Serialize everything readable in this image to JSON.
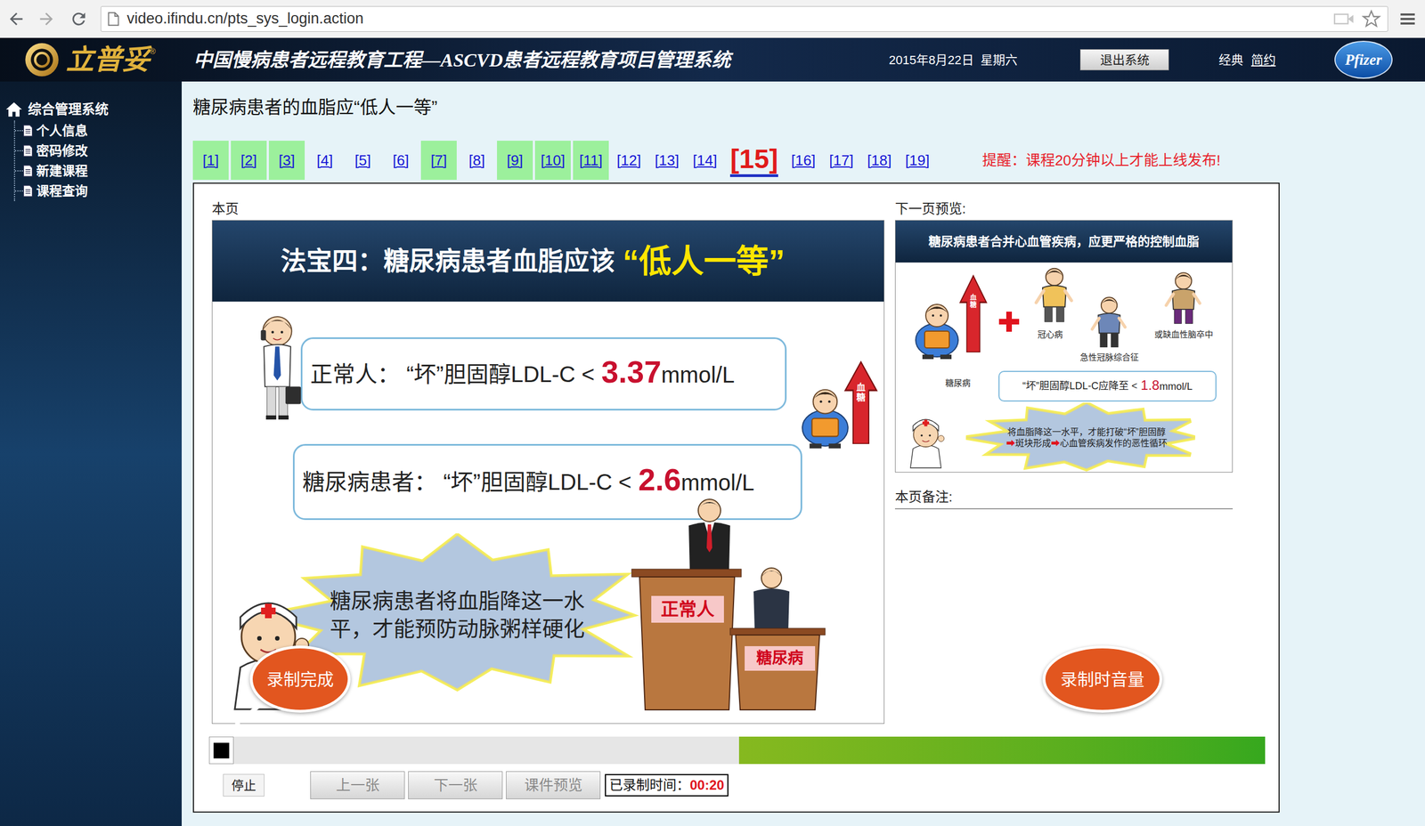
{
  "browser": {
    "url": "video.ifindu.cn/pts_sys_login.action"
  },
  "header": {
    "brand": "立普妥",
    "brand_mark": "®",
    "title": "中国慢病患者远程教育工程—ASCVD患者远程教育项目管理系统",
    "date": "2015年8月22日  星期六",
    "logout": "退出系统",
    "styles": [
      {
        "label": "经典",
        "selected": true
      },
      {
        "label": "简约",
        "selected": false
      }
    ],
    "sponsor": "Pfizer"
  },
  "sidebar": {
    "root": "综合管理系统",
    "items": [
      {
        "label": "个人信息"
      },
      {
        "label": "密码修改"
      },
      {
        "label": "新建课程"
      },
      {
        "label": "课程查询"
      }
    ]
  },
  "course": {
    "title": "糖尿病患者的血脂应“低人一等”",
    "pages": [
      {
        "label": "[1]",
        "done": true,
        "selected": false
      },
      {
        "label": "[2]",
        "done": true,
        "selected": false
      },
      {
        "label": "[3]",
        "done": true,
        "selected": false
      },
      {
        "label": "[4]",
        "done": false,
        "selected": false
      },
      {
        "label": "[5]",
        "done": false,
        "selected": false
      },
      {
        "label": "[6]",
        "done": false,
        "selected": false
      },
      {
        "label": "[7]",
        "done": true,
        "selected": false
      },
      {
        "label": "[8]",
        "done": false,
        "selected": false
      },
      {
        "label": "[9]",
        "done": true,
        "selected": false
      },
      {
        "label": "[10]",
        "done": true,
        "selected": false
      },
      {
        "label": "[11]",
        "done": true,
        "selected": false
      },
      {
        "label": "[12]",
        "done": false,
        "selected": false
      },
      {
        "label": "[13]",
        "done": false,
        "selected": false
      },
      {
        "label": "[14]",
        "done": false,
        "selected": false
      },
      {
        "label": "[15]",
        "done": false,
        "selected": true
      },
      {
        "label": "[16]",
        "done": false,
        "selected": false
      },
      {
        "label": "[17]",
        "done": false,
        "selected": false
      },
      {
        "label": "[18]",
        "done": false,
        "selected": false
      },
      {
        "label": "[19]",
        "done": false,
        "selected": false
      }
    ],
    "reminder": "提醒：课程20分钟以上才能上线发布!"
  },
  "current": {
    "label": "本页",
    "slide": {
      "title": "法宝四：糖尿病患者血脂应该",
      "highlight": "“低人一等”",
      "rows": [
        {
          "who": "正常人：",
          "text": "“坏”胆固醇LDL-C <",
          "value": "3.37",
          "unit": "mmol/L"
        },
        {
          "who": "糖尿病患者：",
          "text": "“坏”胆固醇LDL-C <",
          "value": "2.6",
          "unit": "mmol/L"
        }
      ],
      "burst": "糖尿病患者将血脂降这一水平，才能预防动脉粥样硬化",
      "arrow_label": "血糖",
      "podiums": [
        "正常人",
        "糖尿病"
      ]
    }
  },
  "preview": {
    "label": "下一页预览:",
    "slide": {
      "title": "糖尿病患者合并心血管疾病，应更严格的控制血脂",
      "arrow_label": "血糖",
      "diseases": [
        "冠心病",
        "急性冠脉综合征",
        "或缺血性脑卒中"
      ],
      "patient": "糖尿病",
      "target": {
        "text": "“坏”胆固醇LDL-C应降至 <",
        "value": "1.8",
        "unit": "mmol/L"
      },
      "burst": "将血脂降这一水平，才能打破“坏”胆固醇➡斑块形成➡心血管疾病发作的恶性循环"
    }
  },
  "notes": {
    "label": "本页备注:"
  },
  "recorder": {
    "level": 0.51,
    "stop": "停止",
    "buttons": [
      {
        "label": "上一张",
        "disabled": true
      },
      {
        "label": "下一张",
        "disabled": true
      },
      {
        "label": "课件预览",
        "disabled": true
      }
    ],
    "elapsed_label": "已录制时间：",
    "elapsed": "00:20"
  },
  "callouts": [
    "录制完成",
    "录制时音量"
  ]
}
